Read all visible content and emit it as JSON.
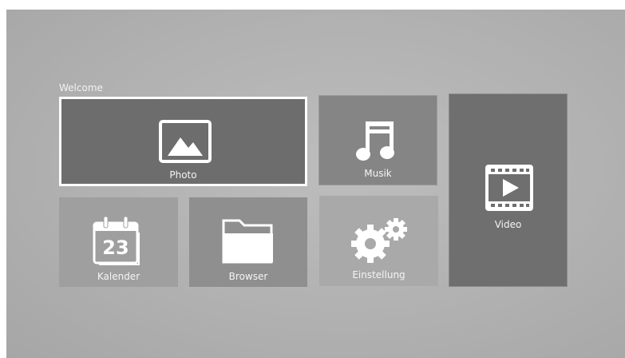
{
  "header": {
    "welcome": "Welcome"
  },
  "tiles": {
    "photo": {
      "label": "Photo",
      "icon": "image-icon"
    },
    "musik": {
      "label": "Musik",
      "icon": "music-note-icon"
    },
    "video": {
      "label": "Video",
      "icon": "film-play-icon"
    },
    "kalender": {
      "label": "Kalender",
      "icon": "calendar-icon",
      "icon_text": "23"
    },
    "browser": {
      "label": "Browser",
      "icon": "folder-icon"
    },
    "einstellung": {
      "label": "Einstellung",
      "icon": "gears-icon"
    }
  },
  "selected_tile": "photo",
  "colors": {
    "selection_border": "#ffffff",
    "tile_text": "#ffffff"
  }
}
